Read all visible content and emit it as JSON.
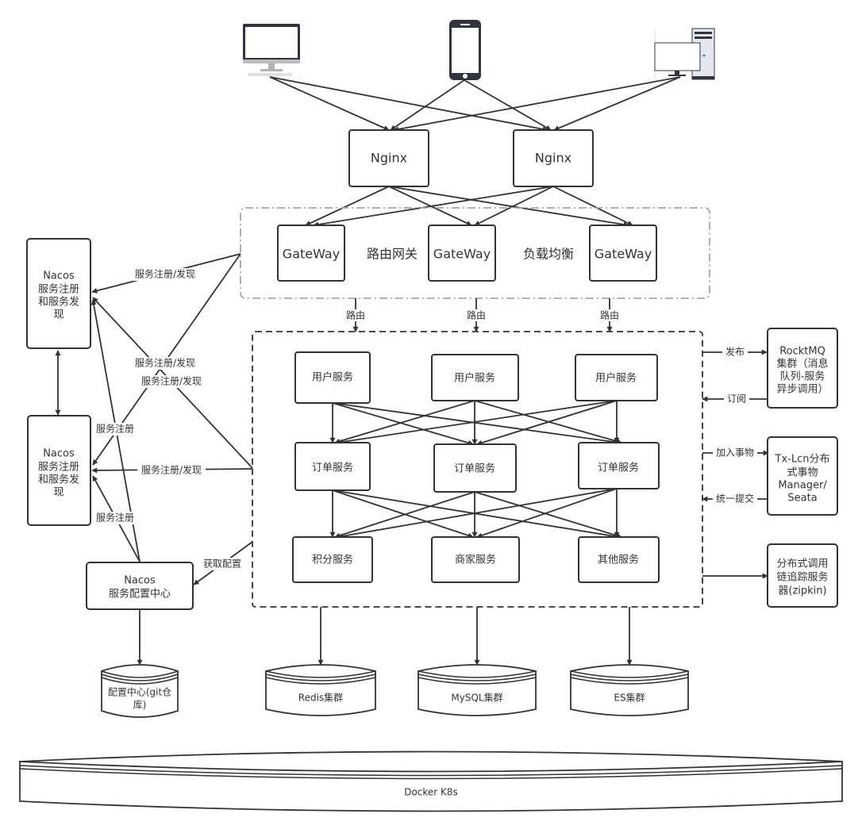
{
  "clients": [
    {
      "name": "desktop-client",
      "icon": "desktop-monitor-icon"
    },
    {
      "name": "mobile-client",
      "icon": "smartphone-icon"
    },
    {
      "name": "pc-client",
      "icon": "pc-tower-icon"
    }
  ],
  "nginx": [
    "Nginx",
    "Nginx"
  ],
  "gateway_layer": {
    "nodes": [
      "GateWay",
      "GateWay",
      "GateWay"
    ],
    "label_routing": "路由网关",
    "label_lb": "负载均衡",
    "route_label": "路由"
  },
  "services": {
    "row1": [
      "用户服务",
      "用户服务",
      "用户服务"
    ],
    "row2": [
      "订单服务",
      "订单服务",
      "订单服务"
    ],
    "row3": [
      "积分服务",
      "商家服务",
      "其他服务"
    ]
  },
  "nacos_registry": {
    "title": "Nacos",
    "lines": [
      "服务注册",
      "和服务发",
      "现"
    ]
  },
  "nacos_config": {
    "title": "Nacos",
    "subtitle": "服务配置中心"
  },
  "edge_labels": {
    "reg_discover": "服务注册/发现",
    "register": "服务注册",
    "get_config": "获取配置",
    "publish": "发布",
    "subscribe": "订阅",
    "join_tx": "加入事物",
    "commit": "统一提交"
  },
  "right_panel": {
    "mq": [
      "RocktMQ",
      "集群（消息",
      "队列-服务",
      "异步调用）"
    ],
    "tx": [
      "Tx-Lcn分布",
      "式事物",
      "Manager/",
      "Seata"
    ],
    "trace": [
      "分布式调用",
      "链追踪服务",
      "器(zipkin)"
    ]
  },
  "storage": {
    "config_repo": [
      "配置中心(git仓",
      "库)"
    ],
    "redis": "Redis集群",
    "mysql": "MySQL集群",
    "es": "ES集群"
  },
  "platform": "Docker K8s",
  "colors": {
    "stroke": "#333333",
    "gateway_border": "#a6a6a6",
    "icon_dark": "#2f3440",
    "icon_grey": "#b3b3b3",
    "icon_blue": "#3b7ddd"
  }
}
